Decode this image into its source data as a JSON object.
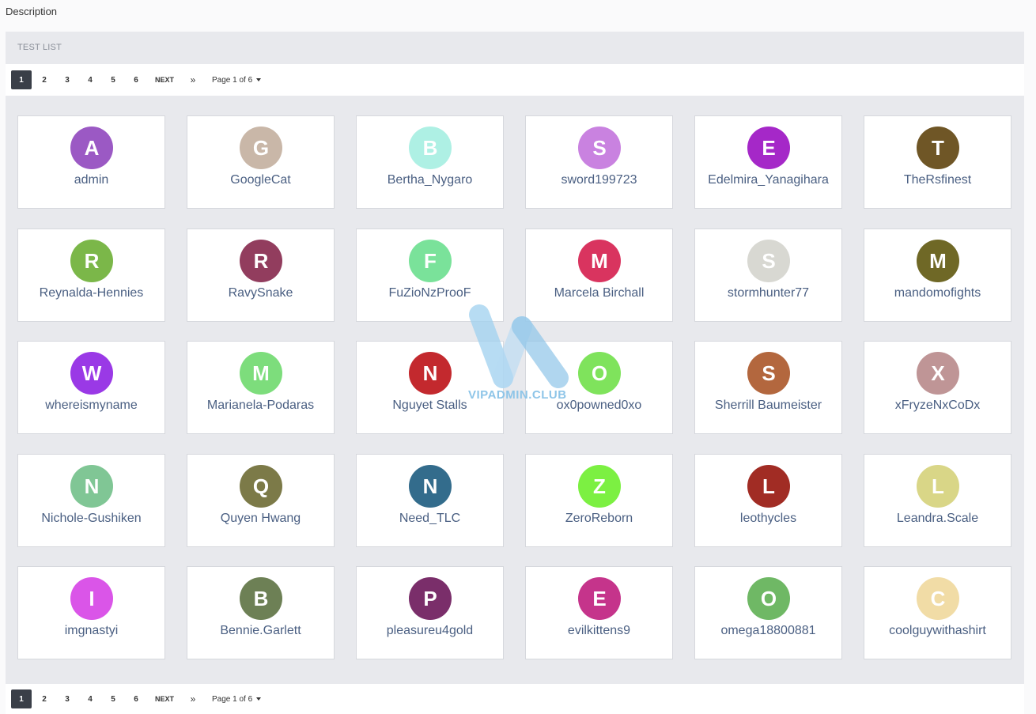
{
  "description_label": "Description",
  "list_title": "TEST LIST",
  "pagination": {
    "pages": [
      "1",
      "2",
      "3",
      "4",
      "5",
      "6"
    ],
    "active_page": "1",
    "next_label": "NEXT",
    "last_label": "»",
    "page_of_label": "Page 1 of 6"
  },
  "watermark": "VIPADMIN.CLUB",
  "users": [
    {
      "initial": "A",
      "name": "admin",
      "color": "#9b59c4"
    },
    {
      "initial": "G",
      "name": "GoogleCat",
      "color": "#c9b7a8"
    },
    {
      "initial": "B",
      "name": "Bertha_Nygaro",
      "color": "#aef0e4"
    },
    {
      "initial": "S",
      "name": "sword199723",
      "color": "#c982e0"
    },
    {
      "initial": "E",
      "name": "Edelmira_Yanagihara",
      "color": "#a528c8"
    },
    {
      "initial": "T",
      "name": "TheRsfinest",
      "color": "#6f5626"
    },
    {
      "initial": "R",
      "name": "Reynalda-Hennies",
      "color": "#7bb749"
    },
    {
      "initial": "R",
      "name": "RavySnake",
      "color": "#923d5e"
    },
    {
      "initial": "F",
      "name": "FuZioNzProoF",
      "color": "#7ae29a"
    },
    {
      "initial": "M",
      "name": "Marcela Birchall",
      "color": "#d9345f"
    },
    {
      "initial": "S",
      "name": "stormhunter77",
      "color": "#d8d8d2"
    },
    {
      "initial": "M",
      "name": "mandomofights",
      "color": "#6f6826"
    },
    {
      "initial": "W",
      "name": "whereismyname",
      "color": "#9a39e6"
    },
    {
      "initial": "M",
      "name": "Marianela-Podaras",
      "color": "#7ddd7c"
    },
    {
      "initial": "N",
      "name": "Nguyet Stalls",
      "color": "#c3292e"
    },
    {
      "initial": "O",
      "name": "ox0powned0xo",
      "color": "#7fe35c"
    },
    {
      "initial": "S",
      "name": "Sherrill Baumeister",
      "color": "#b3673e"
    },
    {
      "initial": "X",
      "name": "xFryzeNxCoDx",
      "color": "#bf9596"
    },
    {
      "initial": "N",
      "name": "Nichole-Gushiken",
      "color": "#80c695"
    },
    {
      "initial": "Q",
      "name": "Quyen Hwang",
      "color": "#7c7a48"
    },
    {
      "initial": "N",
      "name": "Need_TLC",
      "color": "#336c8c"
    },
    {
      "initial": "Z",
      "name": "ZeroReborn",
      "color": "#7cf042"
    },
    {
      "initial": "L",
      "name": "leothycles",
      "color": "#a12c24"
    },
    {
      "initial": "L",
      "name": "Leandra.Scale",
      "color": "#d9d687"
    },
    {
      "initial": "I",
      "name": "imgnastyi",
      "color": "#da55e8"
    },
    {
      "initial": "B",
      "name": "Bennie.Garlett",
      "color": "#6d8055"
    },
    {
      "initial": "P",
      "name": "pleasureu4gold",
      "color": "#7a2e6a"
    },
    {
      "initial": "E",
      "name": "evilkittens9",
      "color": "#c5348b"
    },
    {
      "initial": "O",
      "name": "omega18800881",
      "color": "#6fb865"
    },
    {
      "initial": "C",
      "name": "coolguywithashirt",
      "color": "#f1dca6"
    }
  ]
}
